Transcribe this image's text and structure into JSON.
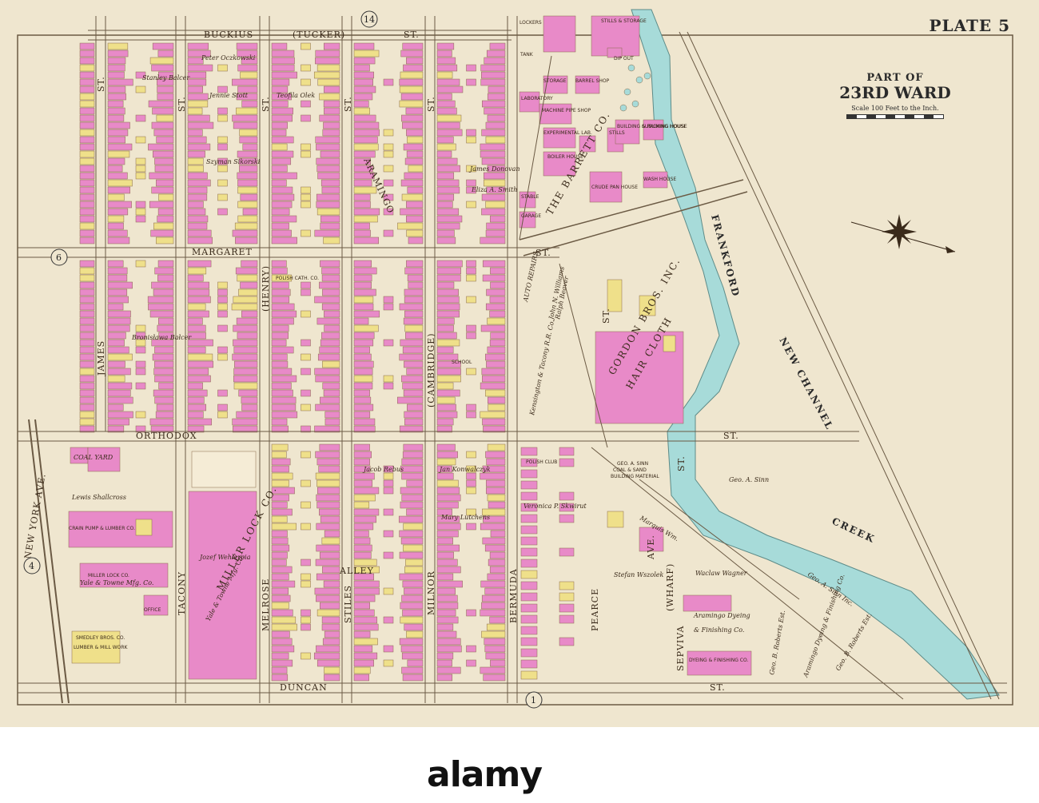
{
  "plate": {
    "title": "PLATE 5"
  },
  "ward": {
    "part": "PART OF",
    "name": "23RD WARD",
    "scale": "Scale 100 Feet to the Inch."
  },
  "streets": {
    "buckius": "BUCKIUS",
    "tucker": "(TUCKER)",
    "st": "ST.",
    "margaret": "MARGARET",
    "orthodox": "ORTHODOX",
    "duncan": "DUNCAN",
    "james": "JAMES",
    "tacony": "TACONY",
    "melrose": "MELROSE",
    "stiles": "STILES",
    "milnor": "MILNOR",
    "bermuda": "BERMUDA",
    "pearce": "PEARCE",
    "sepviva": "SEPVIVA",
    "wharf": "(WHARF)",
    "aramingo": "ARAMINGO",
    "ave": "AVE.",
    "henry": "(HENRY)",
    "cambridge": "(CAMBRIDGE)",
    "alley": "ALLEY",
    "new_york_ave": "NEW YORK AVE."
  },
  "sections": {
    "n14": "14",
    "n6": "6",
    "n4": "4",
    "n1": "1"
  },
  "water": {
    "frankford": "FRANKFORD",
    "creek": "CREEK",
    "new_channel": "NEW CHANNEL"
  },
  "owners": {
    "barrett": "THE BARRETT CO.",
    "gordon": "GORDON BROS. INC.",
    "hair_cloth": "HAIR CLOTH",
    "miller_lock": "MILLER LOCK CO.",
    "yale_towne": "Yale & Towne Mfg. Co.",
    "crain": "CRAIN PUMP & LUMBER CO.",
    "miller_lock_office": "MILLER LOCK CO.",
    "yale_towne_2": "Yale & Towne Mfg. Co.",
    "office": "OFFICE",
    "smedley": "SMEDLEY BROS. CO.",
    "lumber": "LUMBER & MILL WORK",
    "lewis": "Lewis Shallcross",
    "coal_yard": "COAL YARD",
    "sinn_coal": "GEO. A. SINN",
    "sinn_coal2": "COAL & SAND",
    "sinn_coal3": "BUILDING MATERIAL",
    "geo_sinn": "Geo. A. Sinn",
    "geo_sinn_inc": "Geo. A. Sinn Inc.",
    "veronica": "Veronica P. Skwirut",
    "mary": "Mary Lutchens",
    "waclaw": "Waclaw Wagner",
    "stefan": "Stefan Wszolek",
    "aramingo_dye": "Aramingo Dyeing",
    "aramingo_dye2": "& Finishing Co.",
    "dye_fin": "DYEING & FINISHING CO.",
    "roberts": "Geo. B. Roberts Est.",
    "roberts2": "Geo. B. Roberts Est.",
    "aramingo_dye3": "Aramingo Dyeing & Finishing Co.",
    "kensington": "Kensington & Tacony R.R. Co.",
    "john_williams": "John N. Williams",
    "peter": "Peter Oczkowski",
    "stanley": "Stanley Balcer",
    "jennie": "Jennie Stott",
    "teofila": "Teofila Olek",
    "szyman": "Szyman Sikorski",
    "james_donovan": "James Donovan",
    "eliza": "Eliza A. Smith",
    "polish": "POLISH CATH. CO.",
    "polish_club": "POLISH CLUB",
    "jan": "Jan Konwalczyk",
    "jozef": "Jozef Wehlerpia",
    "bezos": "Bronisława Bałcer",
    "hockey": "Jacob Rebus",
    "school": "SCHOOL",
    "marquis": "Marquis Wm.",
    "ralph": "Ralph Beaver"
  },
  "industrial": {
    "stills_storage": "STILLS & STORAGE",
    "storage": "STORAGE",
    "barrel": "BARREL SHOP",
    "laboratory": "LABORATORY",
    "machine": "MACHINE PIPE SHOP",
    "exp_lab": "EXPERIMENTAL LAB.",
    "stills": "STILLS",
    "building": "BUILDING & PACKING HOUSE",
    "sublimer": "SUBLIMING HOUSE",
    "boiler": "BOILER HOUSE",
    "crude": "CRUDE PAN HOUSE",
    "wash": "WASH HOUSE",
    "stable": "STABLE",
    "garage": "GARAGE",
    "tank": "TANK",
    "lockers": "LOCKERS",
    "dip": "DIP OUT",
    "auto": "AUTO REPAIRS"
  },
  "watermark": {
    "text": "alamy"
  },
  "palette": {
    "paper": "#efe6cf",
    "pink": "#e88ac8",
    "yellow": "#efe08a",
    "blue": "#a7dbd9",
    "line": "#8a6a4a"
  }
}
